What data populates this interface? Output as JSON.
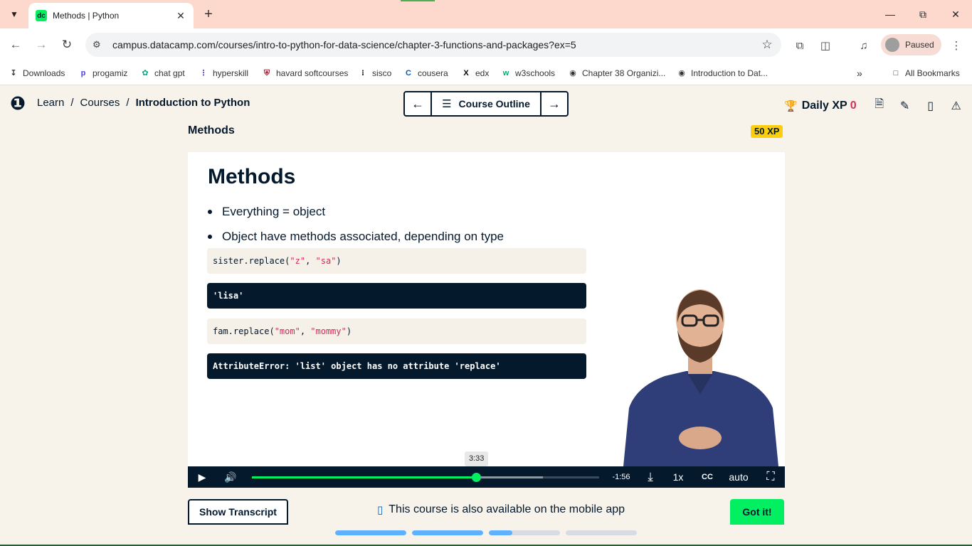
{
  "browser": {
    "tab_title": "Methods | Python",
    "tab_favicon": "dc",
    "url": "campus.datacamp.com/courses/intro-to-python-for-data-science/chapter-3-functions-and-packages?ex=5",
    "profile_status": "Paused",
    "bookmarks": [
      {
        "label": "Downloads",
        "icon": "download-icon"
      },
      {
        "label": "progamiz",
        "icon": "programiz-icon"
      },
      {
        "label": "chat gpt",
        "icon": "chatgpt-icon"
      },
      {
        "label": "hyperskill",
        "icon": "hyperskill-icon"
      },
      {
        "label": "havard softcourses",
        "icon": "harvard-icon"
      },
      {
        "label": "sisco",
        "icon": "cisco-icon"
      },
      {
        "label": "cousera",
        "icon": "coursera-icon"
      },
      {
        "label": "edx",
        "icon": "edx-icon"
      },
      {
        "label": "w3schools",
        "icon": "w3schools-icon"
      },
      {
        "label": "Chapter 38 Organizi...",
        "icon": "globe-icon"
      },
      {
        "label": "Introduction to Dat...",
        "icon": "globe-icon"
      }
    ],
    "all_bookmarks": "All Bookmarks"
  },
  "header": {
    "breadcrumbs": [
      "Learn",
      "Courses",
      "Introduction to Python"
    ],
    "outline_label": "Course Outline",
    "daily_xp_label": "Daily XP",
    "daily_xp_value": "0"
  },
  "exercise": {
    "title": "Methods",
    "xp_badge": "50 XP"
  },
  "slide": {
    "heading": "Methods",
    "bullets": [
      "Everything = object",
      "Object have methods associated, depending on type"
    ],
    "code1": {
      "pre": "sister.replace(",
      "s1": "\"z\"",
      "mid": ", ",
      "s2": "\"sa\"",
      "post": ")"
    },
    "out1": "'lisa'",
    "code2": {
      "pre": "fam.replace(",
      "s1": "\"mom\"",
      "mid": ", ",
      "s2": "\"mommy\"",
      "post": ")"
    },
    "out2": "AttributeError: 'list' object has no attribute 'replace'"
  },
  "video": {
    "hover_time": "3:33",
    "remaining": "-1:56",
    "speed": "1x",
    "quality": "auto",
    "played_fraction": 0.646,
    "buffered_fraction": 0.838
  },
  "footer": {
    "transcript_label": "Show Transcript",
    "mobile_note": "This course is also available on the mobile app",
    "gotit_label": "Got it!",
    "progress": [
      1.0,
      1.0,
      0.33,
      0.0
    ]
  },
  "colors": {
    "brand_green": "#03ef62",
    "navy": "#05192d",
    "xp_yellow": "#fcce0d",
    "accent_pink": "#d12e5b",
    "progress_blue": "#5eb1ff"
  }
}
